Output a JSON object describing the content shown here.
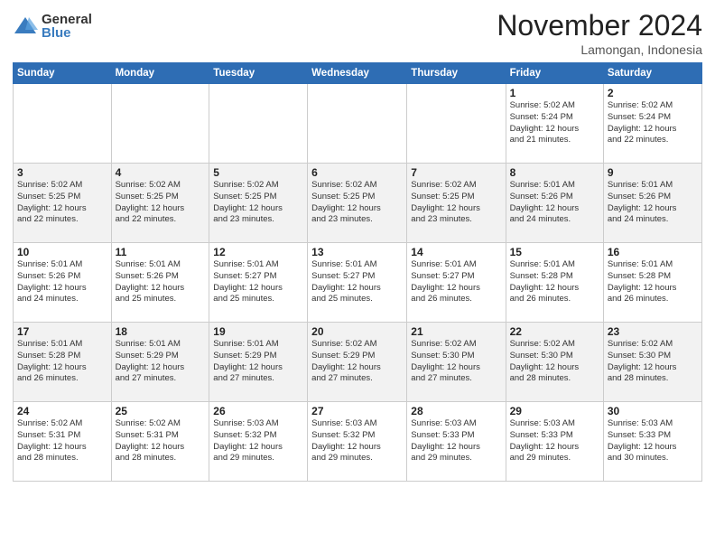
{
  "header": {
    "logo_general": "General",
    "logo_blue": "Blue",
    "month_title": "November 2024",
    "location": "Lamongan, Indonesia"
  },
  "days_of_week": [
    "Sunday",
    "Monday",
    "Tuesday",
    "Wednesday",
    "Thursday",
    "Friday",
    "Saturday"
  ],
  "weeks": [
    [
      {
        "day": "",
        "info": ""
      },
      {
        "day": "",
        "info": ""
      },
      {
        "day": "",
        "info": ""
      },
      {
        "day": "",
        "info": ""
      },
      {
        "day": "",
        "info": ""
      },
      {
        "day": "1",
        "info": "Sunrise: 5:02 AM\nSunset: 5:24 PM\nDaylight: 12 hours\nand 21 minutes."
      },
      {
        "day": "2",
        "info": "Sunrise: 5:02 AM\nSunset: 5:24 PM\nDaylight: 12 hours\nand 22 minutes."
      }
    ],
    [
      {
        "day": "3",
        "info": "Sunrise: 5:02 AM\nSunset: 5:25 PM\nDaylight: 12 hours\nand 22 minutes."
      },
      {
        "day": "4",
        "info": "Sunrise: 5:02 AM\nSunset: 5:25 PM\nDaylight: 12 hours\nand 22 minutes."
      },
      {
        "day": "5",
        "info": "Sunrise: 5:02 AM\nSunset: 5:25 PM\nDaylight: 12 hours\nand 23 minutes."
      },
      {
        "day": "6",
        "info": "Sunrise: 5:02 AM\nSunset: 5:25 PM\nDaylight: 12 hours\nand 23 minutes."
      },
      {
        "day": "7",
        "info": "Sunrise: 5:02 AM\nSunset: 5:25 PM\nDaylight: 12 hours\nand 23 minutes."
      },
      {
        "day": "8",
        "info": "Sunrise: 5:01 AM\nSunset: 5:26 PM\nDaylight: 12 hours\nand 24 minutes."
      },
      {
        "day": "9",
        "info": "Sunrise: 5:01 AM\nSunset: 5:26 PM\nDaylight: 12 hours\nand 24 minutes."
      }
    ],
    [
      {
        "day": "10",
        "info": "Sunrise: 5:01 AM\nSunset: 5:26 PM\nDaylight: 12 hours\nand 24 minutes."
      },
      {
        "day": "11",
        "info": "Sunrise: 5:01 AM\nSunset: 5:26 PM\nDaylight: 12 hours\nand 25 minutes."
      },
      {
        "day": "12",
        "info": "Sunrise: 5:01 AM\nSunset: 5:27 PM\nDaylight: 12 hours\nand 25 minutes."
      },
      {
        "day": "13",
        "info": "Sunrise: 5:01 AM\nSunset: 5:27 PM\nDaylight: 12 hours\nand 25 minutes."
      },
      {
        "day": "14",
        "info": "Sunrise: 5:01 AM\nSunset: 5:27 PM\nDaylight: 12 hours\nand 26 minutes."
      },
      {
        "day": "15",
        "info": "Sunrise: 5:01 AM\nSunset: 5:28 PM\nDaylight: 12 hours\nand 26 minutes."
      },
      {
        "day": "16",
        "info": "Sunrise: 5:01 AM\nSunset: 5:28 PM\nDaylight: 12 hours\nand 26 minutes."
      }
    ],
    [
      {
        "day": "17",
        "info": "Sunrise: 5:01 AM\nSunset: 5:28 PM\nDaylight: 12 hours\nand 26 minutes."
      },
      {
        "day": "18",
        "info": "Sunrise: 5:01 AM\nSunset: 5:29 PM\nDaylight: 12 hours\nand 27 minutes."
      },
      {
        "day": "19",
        "info": "Sunrise: 5:01 AM\nSunset: 5:29 PM\nDaylight: 12 hours\nand 27 minutes."
      },
      {
        "day": "20",
        "info": "Sunrise: 5:02 AM\nSunset: 5:29 PM\nDaylight: 12 hours\nand 27 minutes."
      },
      {
        "day": "21",
        "info": "Sunrise: 5:02 AM\nSunset: 5:30 PM\nDaylight: 12 hours\nand 27 minutes."
      },
      {
        "day": "22",
        "info": "Sunrise: 5:02 AM\nSunset: 5:30 PM\nDaylight: 12 hours\nand 28 minutes."
      },
      {
        "day": "23",
        "info": "Sunrise: 5:02 AM\nSunset: 5:30 PM\nDaylight: 12 hours\nand 28 minutes."
      }
    ],
    [
      {
        "day": "24",
        "info": "Sunrise: 5:02 AM\nSunset: 5:31 PM\nDaylight: 12 hours\nand 28 minutes."
      },
      {
        "day": "25",
        "info": "Sunrise: 5:02 AM\nSunset: 5:31 PM\nDaylight: 12 hours\nand 28 minutes."
      },
      {
        "day": "26",
        "info": "Sunrise: 5:03 AM\nSunset: 5:32 PM\nDaylight: 12 hours\nand 29 minutes."
      },
      {
        "day": "27",
        "info": "Sunrise: 5:03 AM\nSunset: 5:32 PM\nDaylight: 12 hours\nand 29 minutes."
      },
      {
        "day": "28",
        "info": "Sunrise: 5:03 AM\nSunset: 5:33 PM\nDaylight: 12 hours\nand 29 minutes."
      },
      {
        "day": "29",
        "info": "Sunrise: 5:03 AM\nSunset: 5:33 PM\nDaylight: 12 hours\nand 29 minutes."
      },
      {
        "day": "30",
        "info": "Sunrise: 5:03 AM\nSunset: 5:33 PM\nDaylight: 12 hours\nand 30 minutes."
      }
    ]
  ]
}
